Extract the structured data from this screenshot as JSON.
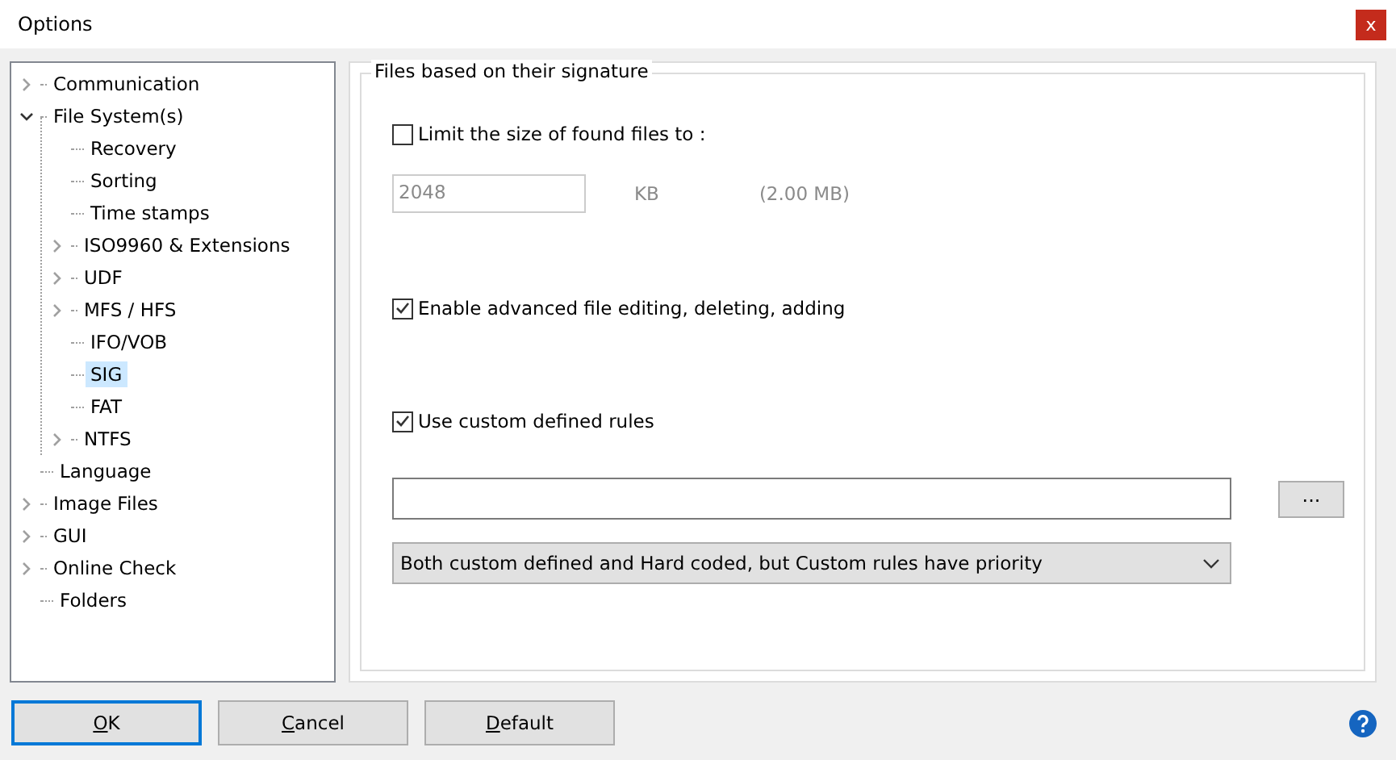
{
  "window": {
    "title": "Options",
    "close": "x"
  },
  "tree": [
    {
      "label": "Communication",
      "expanded": false,
      "selected": false,
      "expandable": true
    },
    {
      "label": "File System(s)",
      "expanded": true,
      "selected": false,
      "expandable": true,
      "children": [
        {
          "label": "Recovery",
          "selected": false
        },
        {
          "label": "Sorting",
          "selected": false
        },
        {
          "label": "Time stamps",
          "selected": false
        },
        {
          "label": "ISO9960 & Extensions",
          "expanded": false,
          "selected": false,
          "expandable": true
        },
        {
          "label": "UDF",
          "expanded": false,
          "selected": false,
          "expandable": true
        },
        {
          "label": "MFS / HFS",
          "expanded": false,
          "selected": false,
          "expandable": true
        },
        {
          "label": "IFO/VOB",
          "selected": false
        },
        {
          "label": "SIG",
          "selected": true
        },
        {
          "label": "FAT",
          "selected": false
        },
        {
          "label": "NTFS",
          "expanded": false,
          "selected": false,
          "expandable": true
        }
      ]
    },
    {
      "label": "Language",
      "selected": false
    },
    {
      "label": "Image Files",
      "expanded": false,
      "selected": false,
      "expandable": true
    },
    {
      "label": "GUI",
      "expanded": false,
      "selected": false,
      "expandable": true
    },
    {
      "label": "Online Check",
      "expanded": false,
      "selected": false,
      "expandable": true
    },
    {
      "label": "Folders",
      "selected": false
    }
  ],
  "group": {
    "title": "Files based on their signature",
    "limit": {
      "label": "Limit the size of found files to :",
      "checked": false,
      "value": "2048",
      "unit": "KB",
      "converted": "(2.00 MB)"
    },
    "advanced": {
      "label": "Enable advanced file editing, deleting, adding",
      "checked": true
    },
    "custom": {
      "label": "Use custom defined rules",
      "checked": true,
      "browse": "...",
      "mode": "Both custom defined and Hard coded, but Custom rules have priority"
    }
  },
  "buttons": [
    {
      "label": "OK",
      "default": true
    },
    {
      "label": "Cancel",
      "default": false
    },
    {
      "label": "Default",
      "default": false
    }
  ]
}
